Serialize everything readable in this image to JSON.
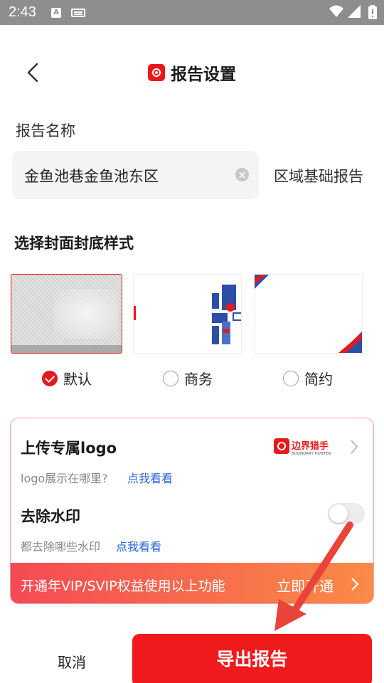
{
  "status_bar": {
    "time": "2:43",
    "input_badge": "A"
  },
  "header": {
    "title": "报告设置"
  },
  "report_name": {
    "label": "报告名称",
    "value": "金鱼池巷金鱼池东区",
    "suffix": "区域基础报告"
  },
  "cover": {
    "label": "选择封面封底样式",
    "options": [
      {
        "label": "默认",
        "selected": true
      },
      {
        "label": "商务",
        "selected": false
      },
      {
        "label": "简约",
        "selected": false
      }
    ]
  },
  "upload_logo": {
    "title": "上传专属logo",
    "hint": "logo展示在哪里?",
    "link": "点我看看",
    "brand_name": "边界猎手",
    "brand_sub": "BOUNDARY HUNTER"
  },
  "watermark": {
    "title": "去除水印",
    "hint": "都去除哪些水印",
    "link": "点我看看",
    "enabled": false
  },
  "vip_banner": {
    "text": "开通年VIP/SVIP权益使用以上功能",
    "action": "立即开通"
  },
  "footer": {
    "cancel": "取消",
    "export": "导出报告"
  },
  "colors": {
    "accent": "#e8191b",
    "link": "#2a67d8",
    "banner_start": "#f54a54",
    "banner_end": "#fa8b46"
  }
}
